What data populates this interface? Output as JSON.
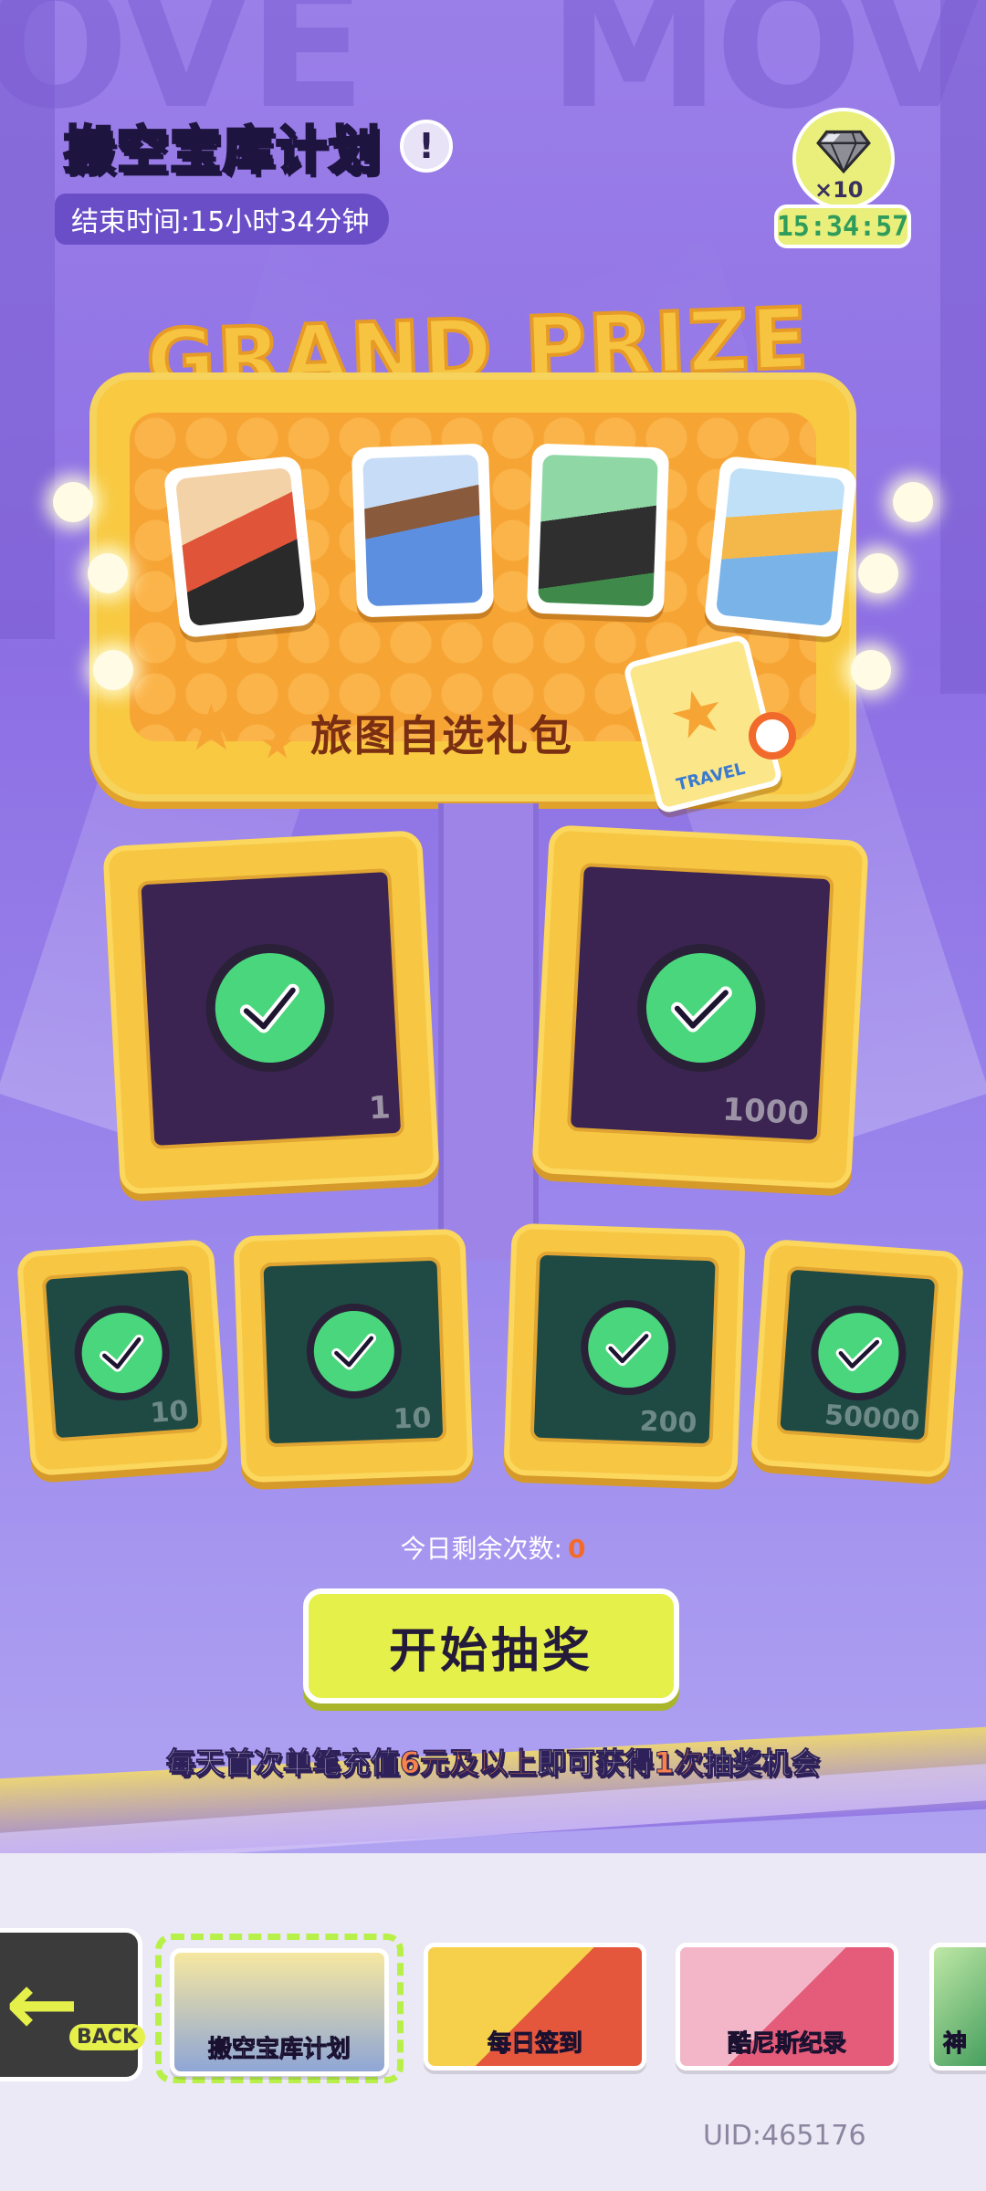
{
  "header": {
    "title_part1": "搬空",
    "title_part2": "宝库计划",
    "info_icon": "exclamation-icon",
    "end_time_label": "结束时间:15小时34分钟"
  },
  "gem_badge": {
    "icon": "diamond-icon",
    "count": "×10",
    "timer": "15:34:57"
  },
  "grand_prize": {
    "banner": "GRAND PRIZE",
    "pack_label": "旅图自选礼包",
    "pack_card_text": "TRAVEL",
    "characters": [
      {
        "name": "character-card-1",
        "color": "#e0553a"
      },
      {
        "name": "character-card-2",
        "color": "#5d8fe0"
      },
      {
        "name": "character-card-3",
        "color": "#3f8a4a"
      },
      {
        "name": "character-card-4",
        "color": "#7ab3e8"
      }
    ]
  },
  "rewards": {
    "large": [
      {
        "qty": "1",
        "claimed": true
      },
      {
        "qty": "1000",
        "claimed": true
      }
    ],
    "small": [
      {
        "qty": "10",
        "claimed": true
      },
      {
        "qty": "10",
        "claimed": true
      },
      {
        "qty": "200",
        "claimed": true
      },
      {
        "qty": "50000",
        "claimed": true
      }
    ]
  },
  "draw": {
    "remaining_label": "今日剩余次数:",
    "remaining_count": "0",
    "button_label": "开始抽奖",
    "rule_part1": "每天首次单笔充值",
    "rule_highlight1": "6元及以上",
    "rule_part2": "即可获得",
    "rule_highlight2": "1次",
    "rule_part3": "抽奖机会"
  },
  "tabs": {
    "back_label": "BACK",
    "items": [
      {
        "label": "搬空宝库计划",
        "selected": true
      },
      {
        "label": "每日签到",
        "selected": false
      },
      {
        "label": "酷尼斯纪录",
        "selected": false
      },
      {
        "label": "神",
        "selected": false
      }
    ]
  },
  "footer": {
    "uid": "UID:465176"
  },
  "colors": {
    "accent_yellow": "#e5f04a",
    "check_green": "#49d67c",
    "highlight_orange": "#f7824c",
    "sign_gold": "#f8c941"
  }
}
